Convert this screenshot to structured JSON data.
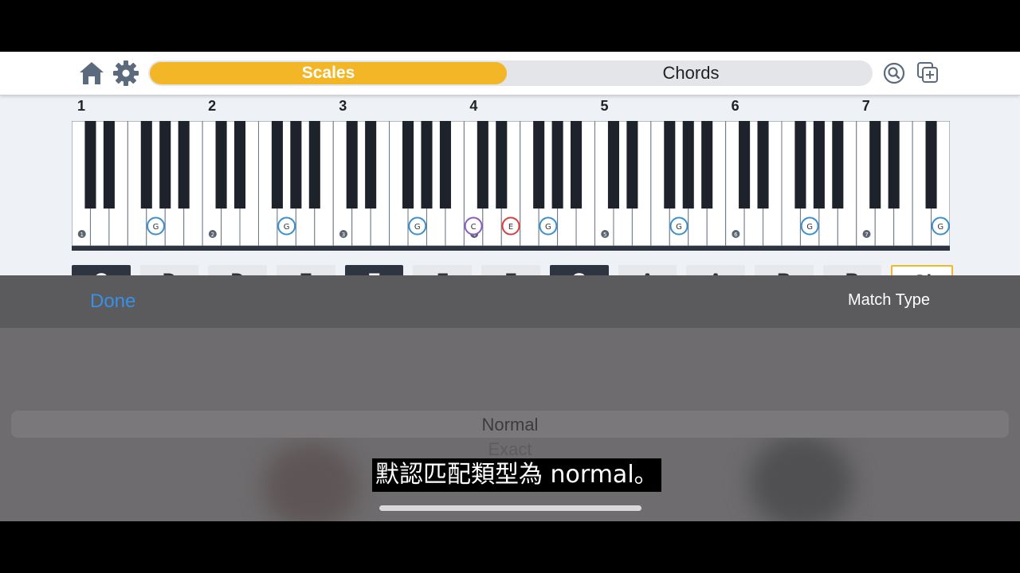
{
  "toolbar": {
    "tabs": [
      {
        "label": "Scales",
        "selected": true
      },
      {
        "label": "Chords",
        "selected": false
      }
    ],
    "icons": [
      "home-icon",
      "gear-icon",
      "search-icon",
      "add-copy-icon"
    ],
    "accent_color": "#f3b626"
  },
  "keyboard": {
    "octave_labels": [
      "1",
      "2",
      "3",
      "4",
      "5",
      "6",
      "7"
    ],
    "marked_notes": [
      {
        "note": "G",
        "octave": 1,
        "color": "#3a8fd0"
      },
      {
        "note": "G",
        "octave": 2,
        "color": "#3a8fd0"
      },
      {
        "note": "G",
        "octave": 3,
        "color": "#3a8fd0"
      },
      {
        "note": "C",
        "octave": 4,
        "color": "#8a5bc0"
      },
      {
        "note": "E",
        "octave": 4,
        "color": "#d64040"
      },
      {
        "note": "G",
        "octave": 4,
        "color": "#3a8fd0"
      },
      {
        "note": "G",
        "octave": 5,
        "color": "#3a8fd0"
      },
      {
        "note": "G",
        "octave": 6,
        "color": "#3a8fd0"
      },
      {
        "note": "G",
        "octave": 7,
        "color": "#3a8fd0"
      }
    ]
  },
  "key_buttons": [
    {
      "label": "C",
      "style": "dark"
    },
    {
      "label": "D",
      "style": "light"
    },
    {
      "label": "D",
      "style": "light"
    },
    {
      "label": "E",
      "style": "light"
    },
    {
      "label": "E",
      "style": "dark"
    },
    {
      "label": "F",
      "style": "light"
    },
    {
      "label": "F",
      "style": "light"
    },
    {
      "label": "G",
      "style": "dark"
    },
    {
      "label": "A",
      "style": "light"
    },
    {
      "label": "A",
      "style": "light"
    },
    {
      "label": "B",
      "style": "light"
    },
    {
      "label": "B",
      "style": "light"
    },
    {
      "label": "Cl",
      "style": "clear"
    }
  ],
  "sheet": {
    "done_label": "Done",
    "title": "Match Type",
    "options": [
      "Normal",
      "Exact"
    ],
    "selected_option": "Normal",
    "done_color": "#3a8fe6"
  },
  "caption": {
    "text": "默認匹配類型為 normal。"
  }
}
